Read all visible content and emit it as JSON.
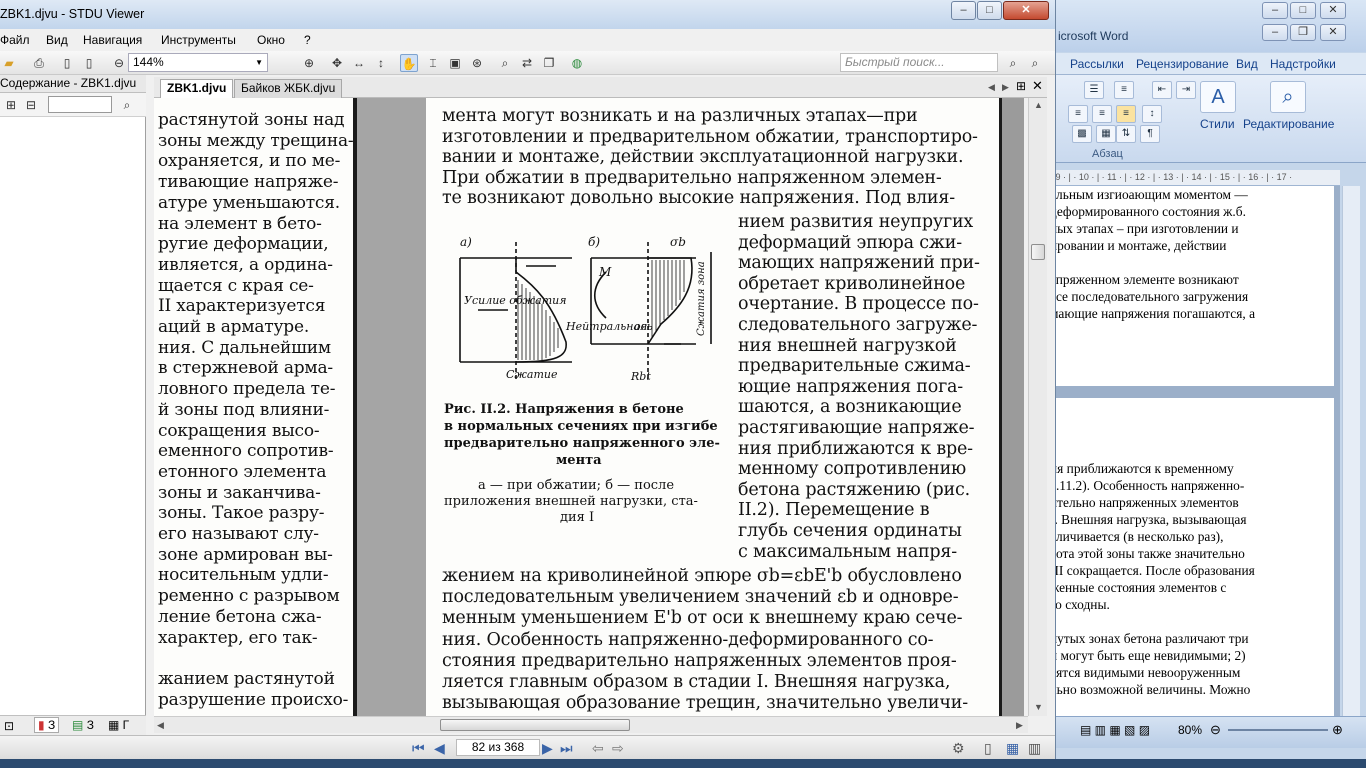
{
  "stdu": {
    "title": "ZBK1.djvu - STDU Viewer",
    "menu": [
      "Файл",
      "Вид",
      "Навигация",
      "Инструменты",
      "Окно",
      "?"
    ],
    "zoom": "144%",
    "search_placeholder": "Быстрый поиск...",
    "left_panel_title": "Содержание - ZBK1.djvu",
    "tabs": [
      "ZBK1.djvu",
      "Байков ЖБК.djvu"
    ],
    "page_indicator": "82 из 368",
    "left_tabs": [
      "З",
      "З",
      "Г"
    ]
  },
  "doc_left": [
    "растянутой зоны над",
    "зоны между трещина-",
    "охраняется, и по ме-",
    "тивающие напряже-",
    "атуре уменьшаются.",
    "на элемент в бето-",
    "ругие деформации,",
    "ивляется, а ордина-",
    "щается с края се-",
    "II характеризуется",
    "аций в арматуре.",
    "ния. С дальнейшим",
    "в стержневой арма-",
    "ловного предела те-",
    "й зоны под влияни-",
    "сокращения высо-",
    "еменного сопротив-",
    "етонного элемента",
    "зоны и заканчива-",
    "зоны. Такое разру-",
    "его называют слу-",
    "зоне армирован вы-",
    "носительным удли-",
    "ременно с разрывом",
    "ление бетона сжа-",
    "характер, его так-",
    "",
    "жанием растянутой",
    "разрушение происхо-"
  ],
  "doc_right_top": [
    "мента  могут возникать   и на различных этапах—при",
    "изготовлении и предварительном обжатии, транспортиро-",
    "вании и монтаже, действии эксплуатационной нагрузки.",
    "    При обжатии в предварительно напряженном элемен-",
    "те возникают довольно высокие напряжения. Под влия-"
  ],
  "doc_right_col": [
    "нием развития неупругих",
    "деформаций эпюра сжи-",
    "мающих напряжений при-",
    "обретает криволинейное",
    "очертание. В процессе по-",
    "следовательного загруже-",
    "ния внешней нагрузкой",
    "предварительные сжима-",
    "ющие напряжения пога-",
    "шаются, а возникающие",
    "растягивающие напряже-",
    "ния приближаются к вре-",
    "менному сопротивлению",
    "бетона растяжению (рис.",
    "II.2).    Перемещение в",
    "глубь сечения ординаты",
    "с максимальным напря-"
  ],
  "doc_right_bottom": [
    "жением на криволинейной эпюре σb=εbE'b обусловлено",
    "последовательным увеличением значений εb и одновре-",
    "менным уменьшением E'b от оси к внешнему краю сече-",
    "ния. Особенность напряженно-деформированного со-",
    "стояния предварительно напряженных элементов проя-",
    "ляется главным образом в стадии I. Внешняя нагрузка,",
    "вызывающая образование трещин, значительно увеличи-"
  ],
  "figure": {
    "label_a": "а)",
    "label_b": "б)",
    "sigma_b": "σb",
    "m": "M",
    "force": "Усилие обжатия",
    "neutral": "Нейтральная",
    "axis": "ось",
    "compression": "Сжатие",
    "rbt": "Rbt",
    "zone": "Сжатия зона",
    "caption": [
      "Рис. II.2.  Напряжения  в  бетоне",
      "в нормальных сечениях при изгибе",
      "предварительно напряженного эле-",
      "мента"
    ],
    "subcaption": [
      "а — при обжатии; б — после",
      "приложения внешней нагрузки, ста-",
      "дия I"
    ]
  },
  "word": {
    "title": "icrosoft Word",
    "tabs": [
      "Рассылки",
      "Рецензирование",
      "Вид",
      "Надстройки"
    ],
    "group_paragraph": "Абзац",
    "styles_label": "Стили",
    "editing_label": "Редактирование",
    "zoom": "80%",
    "ruler": "· 9 · | · 10 · | · 11 · | · 12 · | · 13 · | · 14 · | · 15 · | · 16 · | · 17 ·",
    "page1": [
      "альным изгиоающим моментом —",
      "деформированного состояния ж.б.",
      "ных этапах – при изготовлении и",
      "ировании и монтаже, действии",
      "",
      "апряженном элементе возникают",
      "ссе последовательного загружения",
      "мающие напряжения погашаются, а"
    ],
    "page2": [
      "ия приближаются к временному",
      "с.11.2). Особенность напряженно-",
      "ительно напряженных элементов",
      "I. Внешняя нагрузка, вызывающая",
      "еличивается (в несколько раз),",
      "сота этой зоны также значительно",
      "III сокращается. После образования",
      "женные состояния элементов с",
      "го сходны.",
      "",
      "нутых зонах бетона различают три",
      "и могут быть еще невидимыми; 2)",
      "вятся видимыми невооруженным",
      "льно возможной величины. Можно"
    ]
  }
}
